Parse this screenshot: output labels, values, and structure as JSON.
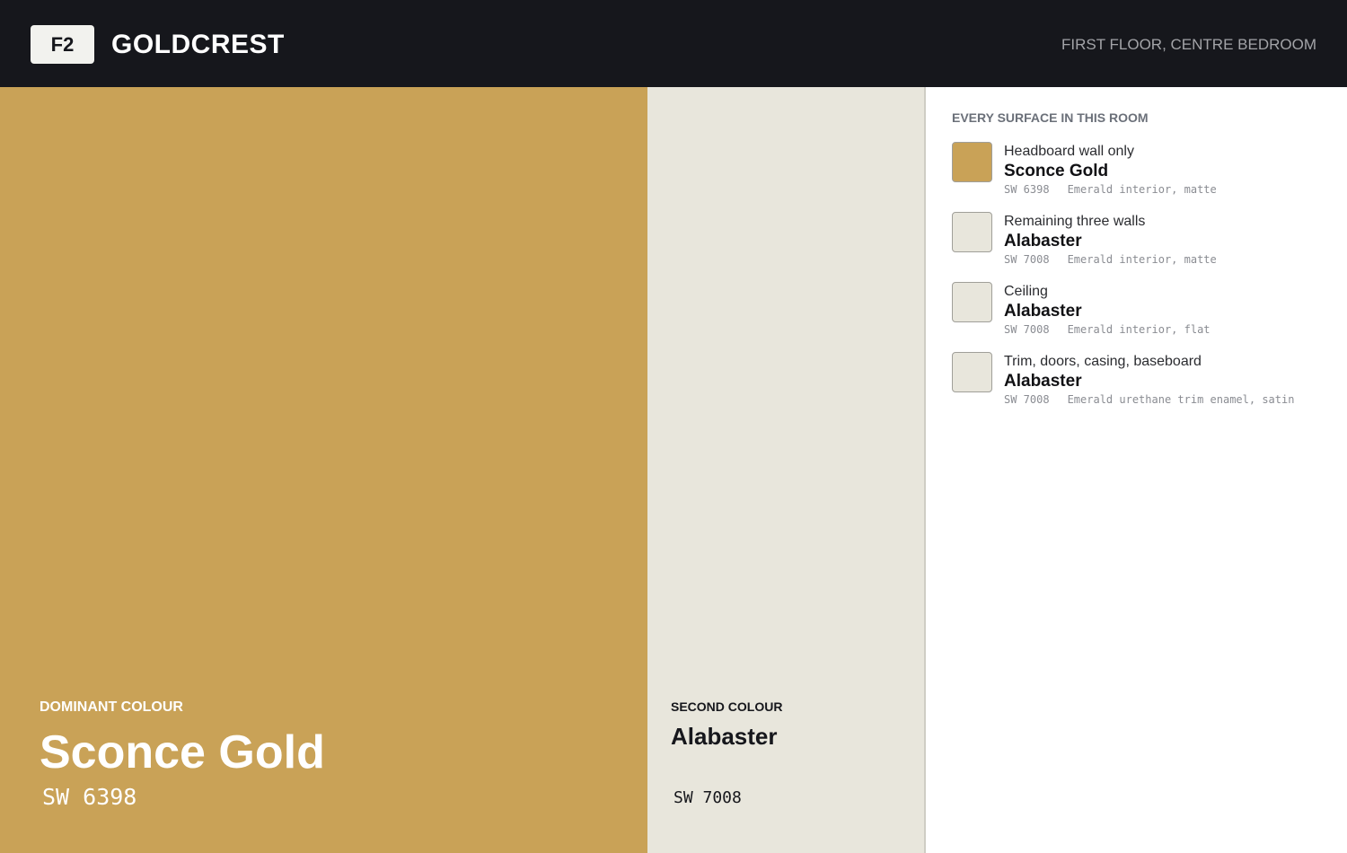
{
  "header": {
    "room_code": "F2",
    "brand": "GOLDCREST",
    "location": "FIRST FLOOR, CENTRE BEDROOM"
  },
  "colors": {
    "dominant_hex": "#c9a257",
    "second_hex": "#e8e6dc",
    "topbar_hex": "#16171c"
  },
  "dominant": {
    "eyebrow": "DOMINANT COLOUR",
    "name": "Sconce Gold",
    "code": "SW 6398"
  },
  "second": {
    "eyebrow": "SECOND COLOUR",
    "name": "Alabaster",
    "code": "SW 7008"
  },
  "panel": {
    "title": "EVERY SURFACE IN THIS ROOM",
    "surfaces": [
      {
        "label": "Headboard wall only",
        "color_name": "Sconce Gold",
        "code": "SW 6398",
        "product": "Emerald interior, matte",
        "swatch": "#c9a257"
      },
      {
        "label": "Remaining three walls",
        "color_name": "Alabaster",
        "code": "SW 7008",
        "product": "Emerald interior, matte",
        "swatch": "#e8e6dc"
      },
      {
        "label": "Ceiling",
        "color_name": "Alabaster",
        "code": "SW 7008",
        "product": "Emerald interior, flat",
        "swatch": "#e8e6dc"
      },
      {
        "label": "Trim, doors, casing, baseboard",
        "color_name": "Alabaster",
        "code": "SW 7008",
        "product": "Emerald urethane trim enamel, satin",
        "swatch": "#e8e6dc"
      }
    ]
  }
}
